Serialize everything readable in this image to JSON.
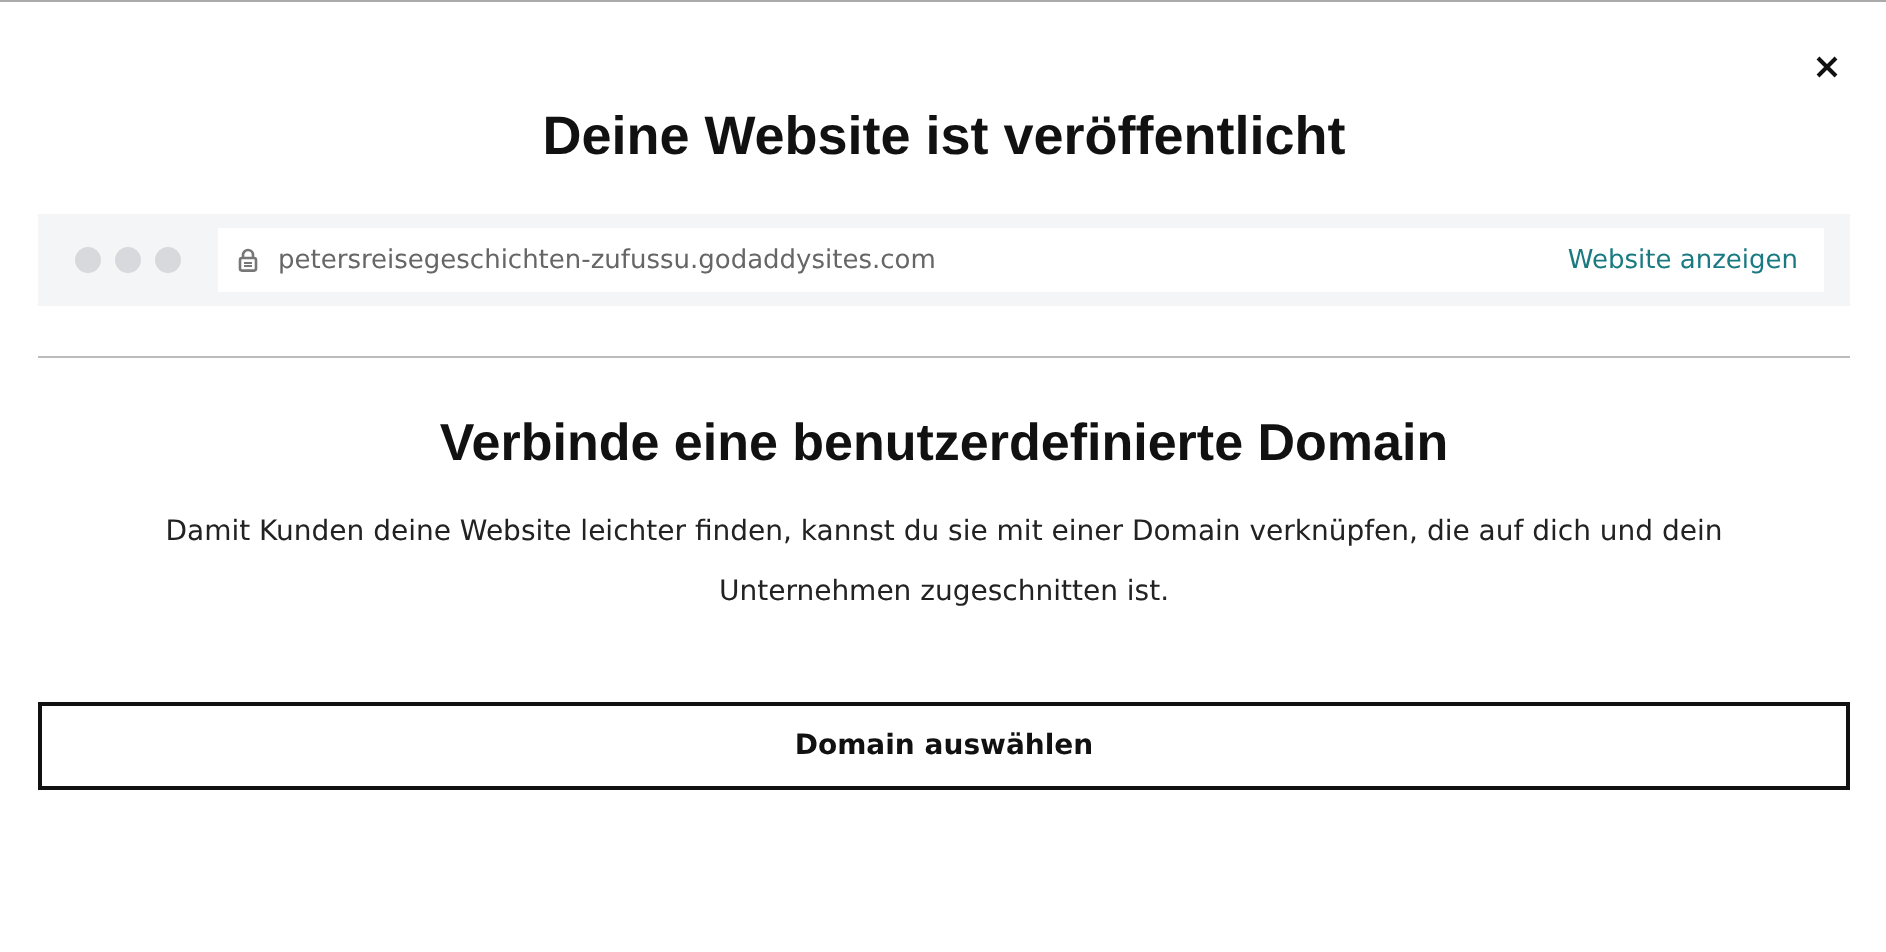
{
  "dialog": {
    "title": "Deine Website ist veröffentlicht"
  },
  "browser_preview": {
    "url": "petersreisegeschichten-zufussu.godaddysites.com",
    "link": "Website anzeigen"
  },
  "domain_section": {
    "heading": "Verbinde eine benutzerdefinierte Domain",
    "description": "Damit Kunden deine Website leichter finden, kannst du sie mit einer Domain verknüpfen, die auf dich und dein Unternehmen zugeschnitten ist.",
    "button": "Domain auswählen"
  }
}
